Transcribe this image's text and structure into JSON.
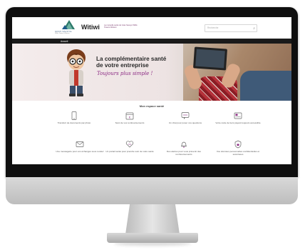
{
  "header": {
    "logo_text": "GRAS SAVOYE",
    "logo_subtext": "Willis Towers Watson",
    "brand": "Witiwi",
    "brand_desc": "La mutuelle santé de Gras Savoye Willis Towers Watson",
    "search_placeholder": "Recherche"
  },
  "nav": {
    "items": [
      {
        "label": "Accueil"
      }
    ]
  },
  "hero": {
    "title_line1": "La complémentaire santé",
    "title_line2": "de votre entreprise",
    "tagline": "Toujours plus simple !"
  },
  "section": {
    "title": "Mon espace santé",
    "features": [
      {
        "label": "Transfert de documents par photo",
        "icon": "phone-icon"
      },
      {
        "label": "Suivi de vos remboursements",
        "icon": "calendar-euro-icon"
      },
      {
        "label": "Un chat pour poser vos questions",
        "icon": "chat-icon"
      },
      {
        "label": "Votre carte de tiers payant toujours accessible",
        "icon": "card-icon"
      },
      {
        "label": "Une messagerie pour vos échanges sous rendez",
        "icon": "mail-icon"
      },
      {
        "label": "Un portail santé pour prendre soin de votre santé",
        "icon": "heart-icon"
      },
      {
        "label": "Des alertes pour vous prévenir des remboursements",
        "icon": "bell-icon"
      },
      {
        "label": "Vos données personnelles confidentielles et sécurisées",
        "icon": "lock-icon"
      }
    ]
  },
  "colors": {
    "accent": "#8b2a83",
    "nav_bg": "#1a1a1a",
    "bezel": "#0f0f0f"
  }
}
